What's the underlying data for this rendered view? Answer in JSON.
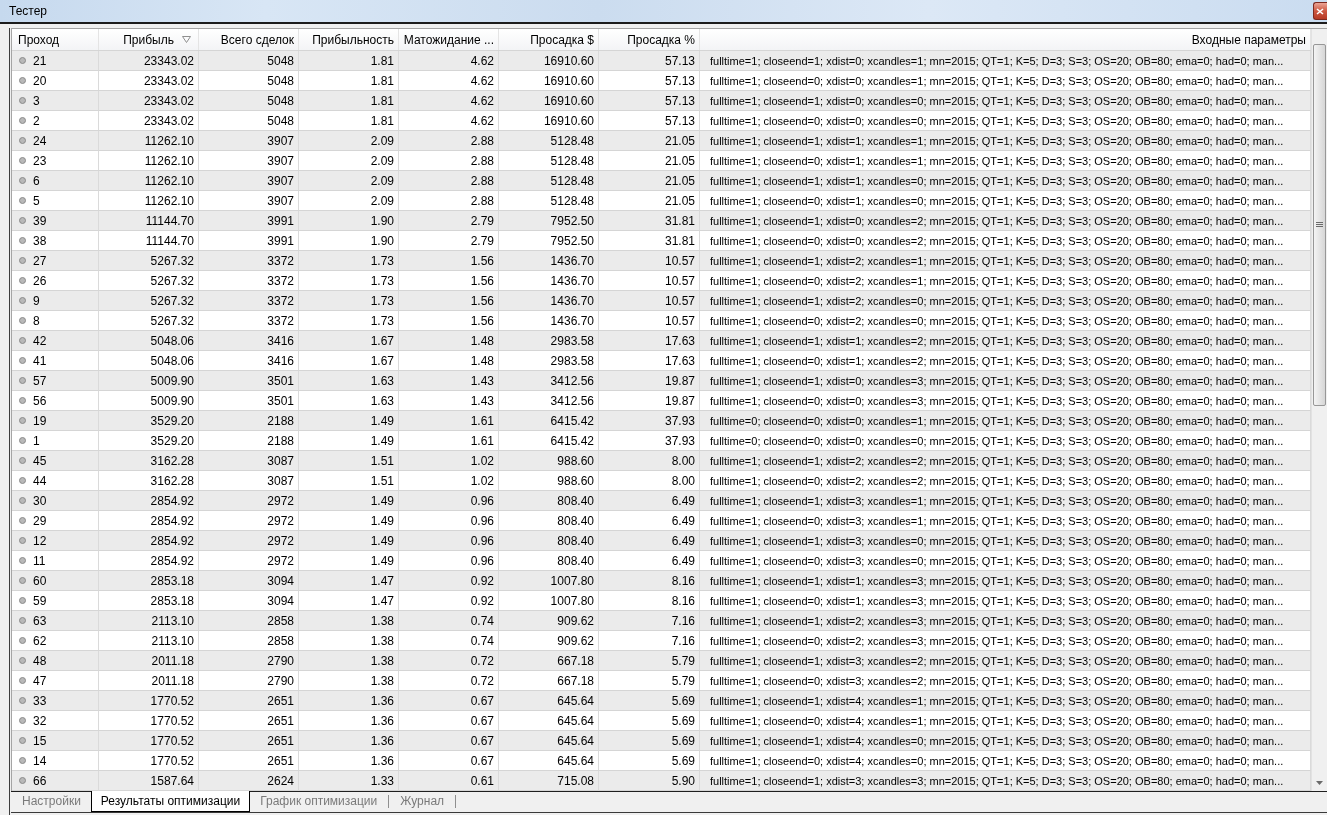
{
  "window": {
    "title": "Тестер"
  },
  "table": {
    "columns": [
      {
        "label": "Проход",
        "sorted": false
      },
      {
        "label": "Прибыль",
        "sorted": true
      },
      {
        "label": "Всего сделок",
        "sorted": false
      },
      {
        "label": "Прибыльность",
        "sorted": false
      },
      {
        "label": "Матожидание ...",
        "sorted": false
      },
      {
        "label": "Просадка $",
        "sorted": false
      },
      {
        "label": "Просадка %",
        "sorted": false
      },
      {
        "label": "Входные параметры",
        "sorted": false
      }
    ],
    "rows": [
      {
        "cells": [
          "21",
          "23343.02",
          "5048",
          "1.81",
          "4.62",
          "16910.60",
          "57.13",
          "fulltime=1; closeend=1; xdist=0; xcandles=1; mn=2015; QT=1; K=5; D=3; S=3; OS=20; OB=80; ema=0; had=0; man..."
        ]
      },
      {
        "cells": [
          "20",
          "23343.02",
          "5048",
          "1.81",
          "4.62",
          "16910.60",
          "57.13",
          "fulltime=1; closeend=0; xdist=0; xcandles=1; mn=2015; QT=1; K=5; D=3; S=3; OS=20; OB=80; ema=0; had=0; man..."
        ]
      },
      {
        "cells": [
          "3",
          "23343.02",
          "5048",
          "1.81",
          "4.62",
          "16910.60",
          "57.13",
          "fulltime=1; closeend=1; xdist=0; xcandles=0; mn=2015; QT=1; K=5; D=3; S=3; OS=20; OB=80; ema=0; had=0; man..."
        ]
      },
      {
        "cells": [
          "2",
          "23343.02",
          "5048",
          "1.81",
          "4.62",
          "16910.60",
          "57.13",
          "fulltime=1; closeend=0; xdist=0; xcandles=0; mn=2015; QT=1; K=5; D=3; S=3; OS=20; OB=80; ema=0; had=0; man..."
        ]
      },
      {
        "cells": [
          "24",
          "11262.10",
          "3907",
          "2.09",
          "2.88",
          "5128.48",
          "21.05",
          "fulltime=1; closeend=1; xdist=1; xcandles=1; mn=2015; QT=1; K=5; D=3; S=3; OS=20; OB=80; ema=0; had=0; man..."
        ]
      },
      {
        "cells": [
          "23",
          "11262.10",
          "3907",
          "2.09",
          "2.88",
          "5128.48",
          "21.05",
          "fulltime=1; closeend=0; xdist=1; xcandles=1; mn=2015; QT=1; K=5; D=3; S=3; OS=20; OB=80; ema=0; had=0; man..."
        ]
      },
      {
        "cells": [
          "6",
          "11262.10",
          "3907",
          "2.09",
          "2.88",
          "5128.48",
          "21.05",
          "fulltime=1; closeend=1; xdist=1; xcandles=0; mn=2015; QT=1; K=5; D=3; S=3; OS=20; OB=80; ema=0; had=0; man..."
        ]
      },
      {
        "cells": [
          "5",
          "11262.10",
          "3907",
          "2.09",
          "2.88",
          "5128.48",
          "21.05",
          "fulltime=1; closeend=0; xdist=1; xcandles=0; mn=2015; QT=1; K=5; D=3; S=3; OS=20; OB=80; ema=0; had=0; man..."
        ]
      },
      {
        "cells": [
          "39",
          "11144.70",
          "3991",
          "1.90",
          "2.79",
          "7952.50",
          "31.81",
          "fulltime=1; closeend=1; xdist=0; xcandles=2; mn=2015; QT=1; K=5; D=3; S=3; OS=20; OB=80; ema=0; had=0; man..."
        ]
      },
      {
        "cells": [
          "38",
          "11144.70",
          "3991",
          "1.90",
          "2.79",
          "7952.50",
          "31.81",
          "fulltime=1; closeend=0; xdist=0; xcandles=2; mn=2015; QT=1; K=5; D=3; S=3; OS=20; OB=80; ema=0; had=0; man..."
        ]
      },
      {
        "cells": [
          "27",
          "5267.32",
          "3372",
          "1.73",
          "1.56",
          "1436.70",
          "10.57",
          "fulltime=1; closeend=1; xdist=2; xcandles=1; mn=2015; QT=1; K=5; D=3; S=3; OS=20; OB=80; ema=0; had=0; man..."
        ]
      },
      {
        "cells": [
          "26",
          "5267.32",
          "3372",
          "1.73",
          "1.56",
          "1436.70",
          "10.57",
          "fulltime=1; closeend=0; xdist=2; xcandles=1; mn=2015; QT=1; K=5; D=3; S=3; OS=20; OB=80; ema=0; had=0; man..."
        ]
      },
      {
        "cells": [
          "9",
          "5267.32",
          "3372",
          "1.73",
          "1.56",
          "1436.70",
          "10.57",
          "fulltime=1; closeend=1; xdist=2; xcandles=0; mn=2015; QT=1; K=5; D=3; S=3; OS=20; OB=80; ema=0; had=0; man..."
        ]
      },
      {
        "cells": [
          "8",
          "5267.32",
          "3372",
          "1.73",
          "1.56",
          "1436.70",
          "10.57",
          "fulltime=1; closeend=0; xdist=2; xcandles=0; mn=2015; QT=1; K=5; D=3; S=3; OS=20; OB=80; ema=0; had=0; man..."
        ]
      },
      {
        "cells": [
          "42",
          "5048.06",
          "3416",
          "1.67",
          "1.48",
          "2983.58",
          "17.63",
          "fulltime=1; closeend=1; xdist=1; xcandles=2; mn=2015; QT=1; K=5; D=3; S=3; OS=20; OB=80; ema=0; had=0; man..."
        ]
      },
      {
        "cells": [
          "41",
          "5048.06",
          "3416",
          "1.67",
          "1.48",
          "2983.58",
          "17.63",
          "fulltime=1; closeend=0; xdist=1; xcandles=2; mn=2015; QT=1; K=5; D=3; S=3; OS=20; OB=80; ema=0; had=0; man..."
        ]
      },
      {
        "cells": [
          "57",
          "5009.90",
          "3501",
          "1.63",
          "1.43",
          "3412.56",
          "19.87",
          "fulltime=1; closeend=1; xdist=0; xcandles=3; mn=2015; QT=1; K=5; D=3; S=3; OS=20; OB=80; ema=0; had=0; man..."
        ]
      },
      {
        "cells": [
          "56",
          "5009.90",
          "3501",
          "1.63",
          "1.43",
          "3412.56",
          "19.87",
          "fulltime=1; closeend=0; xdist=0; xcandles=3; mn=2015; QT=1; K=5; D=3; S=3; OS=20; OB=80; ema=0; had=0; man..."
        ]
      },
      {
        "cells": [
          "19",
          "3529.20",
          "2188",
          "1.49",
          "1.61",
          "6415.42",
          "37.93",
          "fulltime=0; closeend=0; xdist=0; xcandles=1; mn=2015; QT=1; K=5; D=3; S=3; OS=20; OB=80; ema=0; had=0; man..."
        ]
      },
      {
        "cells": [
          "1",
          "3529.20",
          "2188",
          "1.49",
          "1.61",
          "6415.42",
          "37.93",
          "fulltime=0; closeend=0; xdist=0; xcandles=0; mn=2015; QT=1; K=5; D=3; S=3; OS=20; OB=80; ema=0; had=0; man..."
        ]
      },
      {
        "cells": [
          "45",
          "3162.28",
          "3087",
          "1.51",
          "1.02",
          "988.60",
          "8.00",
          "fulltime=1; closeend=1; xdist=2; xcandles=2; mn=2015; QT=1; K=5; D=3; S=3; OS=20; OB=80; ema=0; had=0; man..."
        ]
      },
      {
        "cells": [
          "44",
          "3162.28",
          "3087",
          "1.51",
          "1.02",
          "988.60",
          "8.00",
          "fulltime=1; closeend=0; xdist=2; xcandles=2; mn=2015; QT=1; K=5; D=3; S=3; OS=20; OB=80; ema=0; had=0; man..."
        ]
      },
      {
        "cells": [
          "30",
          "2854.92",
          "2972",
          "1.49",
          "0.96",
          "808.40",
          "6.49",
          "fulltime=1; closeend=1; xdist=3; xcandles=1; mn=2015; QT=1; K=5; D=3; S=3; OS=20; OB=80; ema=0; had=0; man..."
        ]
      },
      {
        "cells": [
          "29",
          "2854.92",
          "2972",
          "1.49",
          "0.96",
          "808.40",
          "6.49",
          "fulltime=1; closeend=0; xdist=3; xcandles=1; mn=2015; QT=1; K=5; D=3; S=3; OS=20; OB=80; ema=0; had=0; man..."
        ]
      },
      {
        "cells": [
          "12",
          "2854.92",
          "2972",
          "1.49",
          "0.96",
          "808.40",
          "6.49",
          "fulltime=1; closeend=1; xdist=3; xcandles=0; mn=2015; QT=1; K=5; D=3; S=3; OS=20; OB=80; ema=0; had=0; man..."
        ]
      },
      {
        "cells": [
          "11",
          "2854.92",
          "2972",
          "1.49",
          "0.96",
          "808.40",
          "6.49",
          "fulltime=1; closeend=0; xdist=3; xcandles=0; mn=2015; QT=1; K=5; D=3; S=3; OS=20; OB=80; ema=0; had=0; man..."
        ]
      },
      {
        "cells": [
          "60",
          "2853.18",
          "3094",
          "1.47",
          "0.92",
          "1007.80",
          "8.16",
          "fulltime=1; closeend=1; xdist=1; xcandles=3; mn=2015; QT=1; K=5; D=3; S=3; OS=20; OB=80; ema=0; had=0; man..."
        ]
      },
      {
        "cells": [
          "59",
          "2853.18",
          "3094",
          "1.47",
          "0.92",
          "1007.80",
          "8.16",
          "fulltime=1; closeend=0; xdist=1; xcandles=3; mn=2015; QT=1; K=5; D=3; S=3; OS=20; OB=80; ema=0; had=0; man..."
        ]
      },
      {
        "cells": [
          "63",
          "2113.10",
          "2858",
          "1.38",
          "0.74",
          "909.62",
          "7.16",
          "fulltime=1; closeend=1; xdist=2; xcandles=3; mn=2015; QT=1; K=5; D=3; S=3; OS=20; OB=80; ema=0; had=0; man..."
        ]
      },
      {
        "cells": [
          "62",
          "2113.10",
          "2858",
          "1.38",
          "0.74",
          "909.62",
          "7.16",
          "fulltime=1; closeend=0; xdist=2; xcandles=3; mn=2015; QT=1; K=5; D=3; S=3; OS=20; OB=80; ema=0; had=0; man..."
        ]
      },
      {
        "cells": [
          "48",
          "2011.18",
          "2790",
          "1.38",
          "0.72",
          "667.18",
          "5.79",
          "fulltime=1; closeend=1; xdist=3; xcandles=2; mn=2015; QT=1; K=5; D=3; S=3; OS=20; OB=80; ema=0; had=0; man..."
        ]
      },
      {
        "cells": [
          "47",
          "2011.18",
          "2790",
          "1.38",
          "0.72",
          "667.18",
          "5.79",
          "fulltime=1; closeend=0; xdist=3; xcandles=2; mn=2015; QT=1; K=5; D=3; S=3; OS=20; OB=80; ema=0; had=0; man..."
        ]
      },
      {
        "cells": [
          "33",
          "1770.52",
          "2651",
          "1.36",
          "0.67",
          "645.64",
          "5.69",
          "fulltime=1; closeend=1; xdist=4; xcandles=1; mn=2015; QT=1; K=5; D=3; S=3; OS=20; OB=80; ema=0; had=0; man..."
        ]
      },
      {
        "cells": [
          "32",
          "1770.52",
          "2651",
          "1.36",
          "0.67",
          "645.64",
          "5.69",
          "fulltime=1; closeend=0; xdist=4; xcandles=1; mn=2015; QT=1; K=5; D=3; S=3; OS=20; OB=80; ema=0; had=0; man..."
        ]
      },
      {
        "cells": [
          "15",
          "1770.52",
          "2651",
          "1.36",
          "0.67",
          "645.64",
          "5.69",
          "fulltime=1; closeend=1; xdist=4; xcandles=0; mn=2015; QT=1; K=5; D=3; S=3; OS=20; OB=80; ema=0; had=0; man..."
        ]
      },
      {
        "cells": [
          "14",
          "1770.52",
          "2651",
          "1.36",
          "0.67",
          "645.64",
          "5.69",
          "fulltime=1; closeend=0; xdist=4; xcandles=0; mn=2015; QT=1; K=5; D=3; S=3; OS=20; OB=80; ema=0; had=0; man..."
        ]
      },
      {
        "cells": [
          "66",
          "1587.64",
          "2624",
          "1.33",
          "0.61",
          "715.08",
          "5.90",
          "fulltime=1; closeend=1; xdist=3; xcandles=3; mn=2015; QT=1; K=5; D=3; S=3; OS=20; OB=80; ema=0; had=0; man..."
        ]
      }
    ]
  },
  "tabs": [
    {
      "label": "Настройки",
      "selected": false
    },
    {
      "label": "Результаты оптимизации",
      "selected": true
    },
    {
      "label": "График оптимизации",
      "selected": false
    },
    {
      "label": "Журнал",
      "selected": false
    }
  ]
}
